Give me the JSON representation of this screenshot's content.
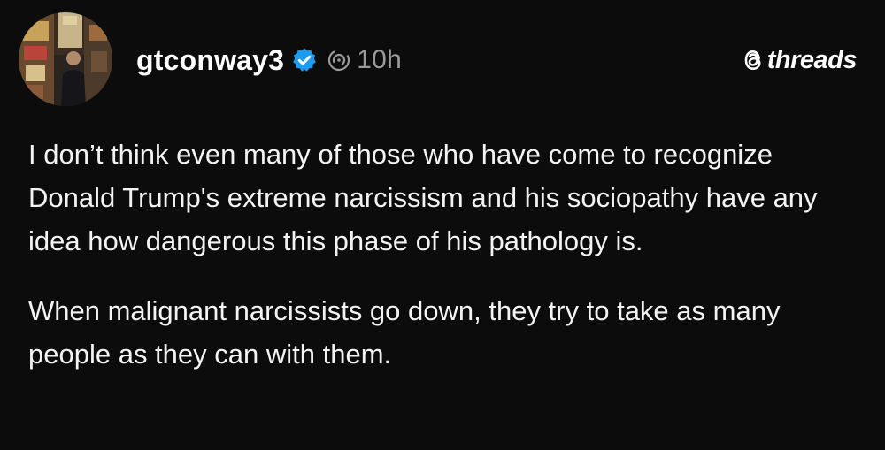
{
  "post": {
    "username": "gtconway3",
    "verified": true,
    "timestamp": "10h",
    "brand": "threads",
    "paragraphs": [
      "I don’t think even many of those who have come to recognize Donald Trump's extreme narcissism and his sociopathy have any idea how dangerous this phase of his pathology is.",
      "When malignant narcissists go down, they try to take as many people as they can with them."
    ]
  },
  "colors": {
    "background": "#0c0c0c",
    "text": "#f3f3f3",
    "muted": "#9a9a9a",
    "verified_badge": "#1d9bf0"
  },
  "icons": {
    "verified": "verified-badge-icon",
    "fediverse": "fediverse-icon",
    "brand": "threads-logo-icon"
  }
}
